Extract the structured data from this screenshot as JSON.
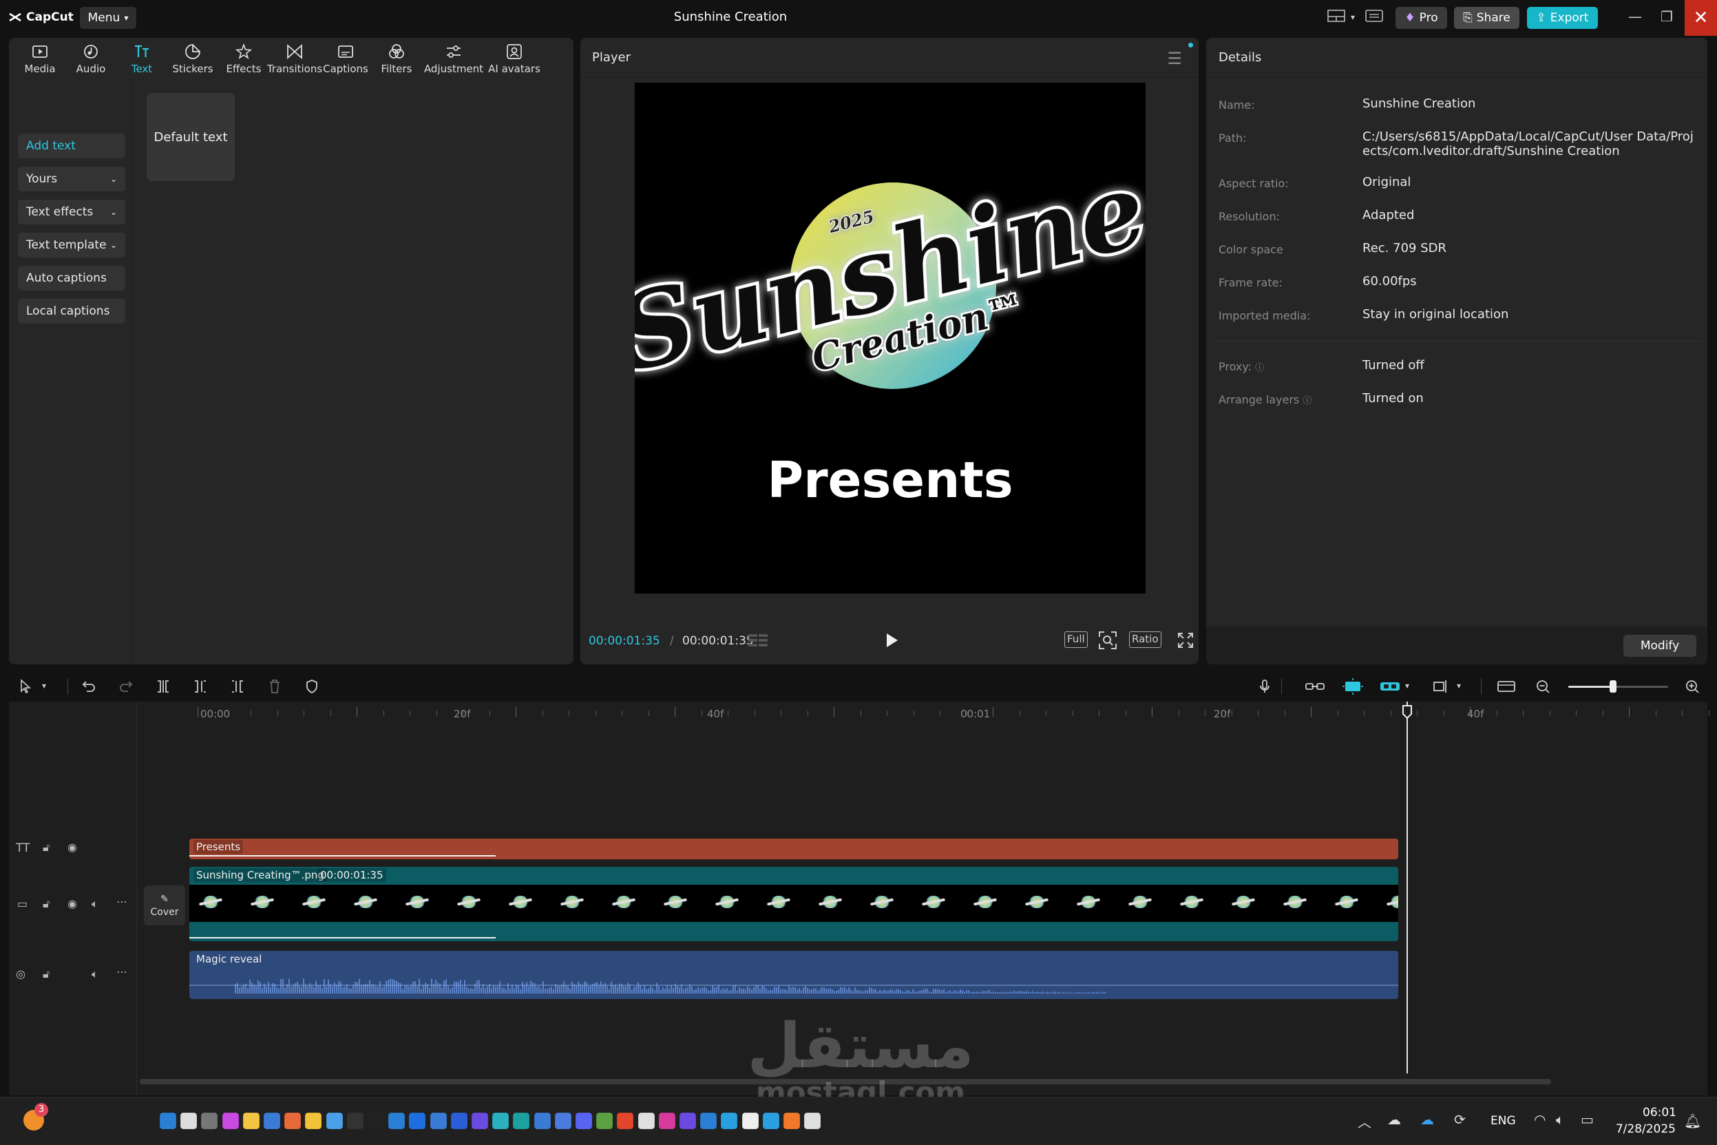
{
  "app": {
    "brand": "CapCut",
    "menu_label": "Menu",
    "window_title": "Sunshine Creation",
    "pro_label": "Pro",
    "share_label": "Share",
    "export_label": "Export",
    "accent_color": "#2ec7e0"
  },
  "toolbar": {
    "items": [
      {
        "label": "Media",
        "icon": "media-icon"
      },
      {
        "label": "Audio",
        "icon": "audio-icon"
      },
      {
        "label": "Text",
        "icon": "text-icon",
        "active": true
      },
      {
        "label": "Stickers",
        "icon": "sticker-icon"
      },
      {
        "label": "Effects",
        "icon": "effects-icon"
      },
      {
        "label": "Transitions",
        "icon": "transitions-icon"
      },
      {
        "label": "Captions",
        "icon": "captions-icon"
      },
      {
        "label": "Filters",
        "icon": "filters-icon"
      },
      {
        "label": "Adjustment",
        "icon": "adjustment-icon"
      },
      {
        "label": "AI avatars",
        "icon": "ai-avatar-icon"
      }
    ]
  },
  "text_sidebar": {
    "add_text": "Add text",
    "yours": "Yours",
    "text_effects": "Text effects",
    "text_template": "Text template",
    "auto_captions": "Auto captions",
    "local_captions": "Local captions",
    "default_text": "Default text"
  },
  "player": {
    "title": "Player",
    "overlay_text": "Presents",
    "current_time": "00:00:01:35",
    "separator": "/",
    "total_time": "00:00:01:35",
    "full_label": "Full",
    "ratio_label": "Ratio",
    "logo": {
      "main": "Sunshine",
      "sub": "Creation™",
      "year": "2025"
    }
  },
  "details": {
    "title": "Details",
    "rows": [
      {
        "label": "Name:",
        "value": "Sunshine Creation"
      },
      {
        "label": "Path:",
        "value": "C:/Users/s6815/AppData/Local/CapCut/User Data/Projects/com.lveditor.draft/Sunshine Creation"
      },
      {
        "label": "Aspect ratio:",
        "value": "Original"
      },
      {
        "label": "Resolution:",
        "value": "Adapted"
      },
      {
        "label": "Color space",
        "value": "Rec. 709 SDR"
      },
      {
        "label": "Frame rate:",
        "value": "60.00fps"
      },
      {
        "label": "Imported media:",
        "value": "Stay in original location"
      },
      {
        "label": "Proxy:",
        "value": "Turned off"
      },
      {
        "label": "Arrange layers",
        "value": "Turned on"
      }
    ],
    "modify_label": "Modify"
  },
  "timeline": {
    "ruler_labels": [
      "00:00",
      "20f",
      "40f",
      "00:01",
      "20f",
      "40f"
    ],
    "text_clip": "Presents",
    "video_clip_name": "Sunshing Creating™.png",
    "video_clip_duration": "00:00:01:35",
    "audio_clip": "Magic reveal",
    "cover_label": "Cover",
    "text_clip_color": "#a1432e",
    "video_clip_color": "#0c5c63",
    "audio_clip_color": "#2e4a7a",
    "zoom_level": 0.45
  },
  "watermark": {
    "arabic": "مستقل",
    "latin": "mostaql.com"
  },
  "taskbar": {
    "notification_count": "3",
    "language": "ENG",
    "time": "06:01",
    "date": "7/28/2025"
  }
}
